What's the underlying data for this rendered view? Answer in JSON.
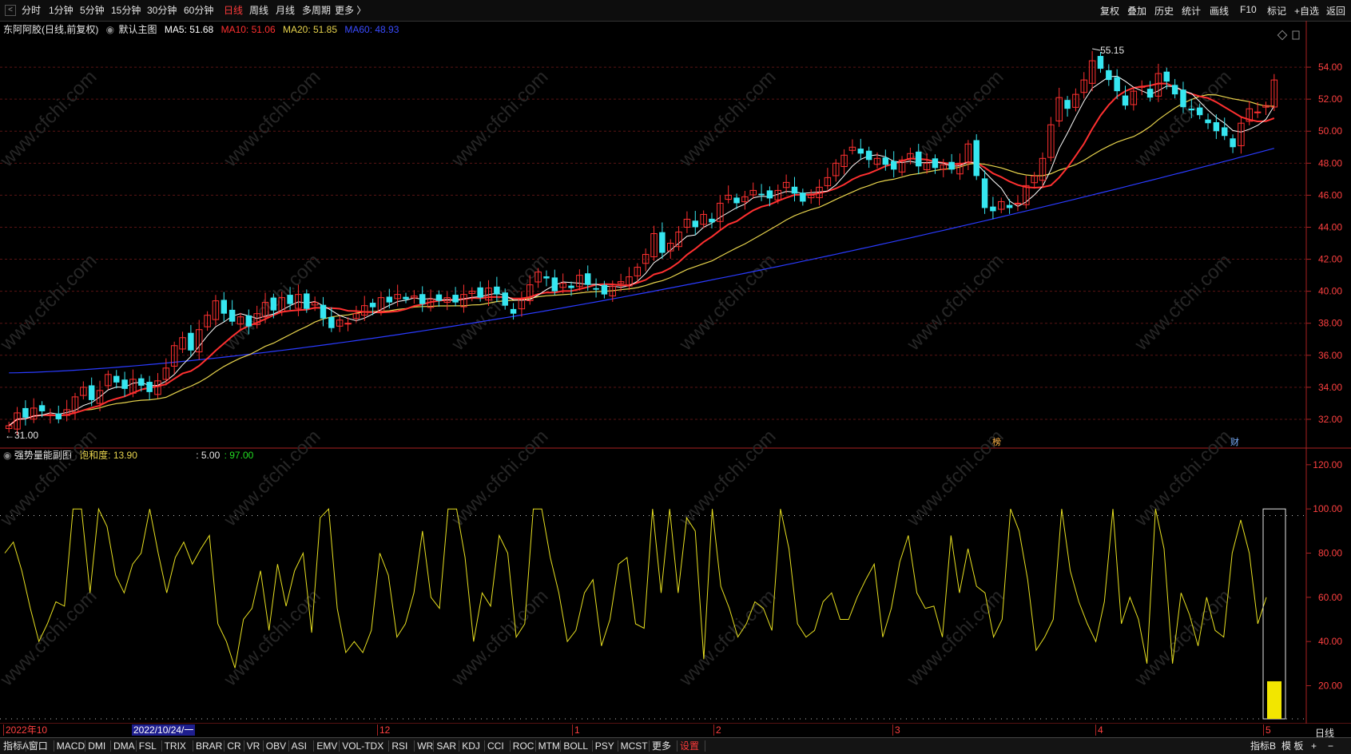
{
  "toolbar": {
    "periods": [
      "分时",
      "1分钟",
      "5分钟",
      "15分钟",
      "30分钟",
      "60分钟",
      "日线",
      "周线",
      "月线",
      "多周期",
      "更多 〉"
    ],
    "active_period": "日线",
    "right_buttons": [
      "复权",
      "叠加",
      "历史",
      "统计",
      "画线",
      "F10",
      "标记",
      "+自选",
      "返回"
    ]
  },
  "legend": {
    "stock": "东阿阿胶(日线,前复权)",
    "main_chart": "默认主图",
    "ma5": "MA5: 51.68",
    "ma10": "MA10: 51.06",
    "ma20": "MA20: 51.85",
    "ma60": "MA60: 48.93",
    "ma5_color": "#ffffff",
    "ma10_color": "#ff3030",
    "ma20_color": "#e8d44d",
    "ma60_color": "#2a3bff"
  },
  "sub_legend": {
    "name": "强势量能副图",
    "saturation": "饱和度: 13.90",
    "v1": ": 5.00",
    "v2": ": 97.00"
  },
  "annotations": {
    "high": "55.15",
    "low": "31.00",
    "marker_bang": "榜",
    "marker_cai": "财",
    "period_label": "日线",
    "cursor_date": "2022/10/24/一"
  },
  "date_axis": [
    "2022年10",
    "12",
    "1",
    "2",
    "3",
    "4",
    "5"
  ],
  "indicator_tabs": [
    "指标A",
    "窗口",
    "MACD",
    "DMI",
    "DMA",
    "FSL",
    "TRIX",
    "BRAR",
    "CR",
    "VR",
    "OBV",
    "ASI",
    "EMV",
    "VOL-TDX",
    "RSI",
    "WR",
    "SAR",
    "KDJ",
    "CCI",
    "ROC",
    "MTM",
    "BOLL",
    "PSY",
    "MCST",
    "更多",
    "设置"
  ],
  "indicator_right": [
    "指标B",
    "模 板",
    "+",
    "−"
  ],
  "chart_data": [
    {
      "type": "candlestick",
      "title": "东阿阿胶(日线,前复权)",
      "ylim": [
        30.5,
        56.2
      ],
      "yticks": [
        32,
        34,
        36,
        38,
        40,
        42,
        44,
        46,
        48,
        50,
        52,
        54
      ],
      "ytick_labels": [
        "32.00",
        "34.00",
        "36.00",
        "38.00",
        "40.00",
        "42.00",
        "44.00",
        "46.00",
        "48.00",
        "50.00",
        "52.00",
        "54.00"
      ],
      "close": [
        31.6,
        32.4,
        32.1,
        32.7,
        32.5,
        32.3,
        32.0,
        32.6,
        33.4,
        34.0,
        33.2,
        33.8,
        34.8,
        34.3,
        33.9,
        34.5,
        34.1,
        33.7,
        34.4,
        35.2,
        36.6,
        37.1,
        36.3,
        37.6,
        38.5,
        39.4,
        38.6,
        38.1,
        38.4,
        37.8,
        38.6,
        39.3,
        38.8,
        39.6,
        39.2,
        39.8,
        38.9,
        39.3,
        38.3,
        37.7,
        38.2,
        38.0,
        38.6,
        39.1,
        39.0,
        39.6,
        39.3,
        39.8,
        39.5,
        39.7,
        39.2,
        39.5,
        39.4,
        39.6,
        39.3,
        39.8,
        40.0,
        39.6,
        40.2,
        39.8,
        39.1,
        38.6,
        39.5,
        40.4,
        41.2,
        40.8,
        40.0,
        40.5,
        40.2,
        41.0,
        40.4,
        40.1,
        39.8,
        40.3,
        40.6,
        40.9,
        41.5,
        42.3,
        43.6,
        42.4,
        43.0,
        43.7,
        44.5,
        44.0,
        44.8,
        44.3,
        45.5,
        46.0,
        45.5,
        45.9,
        46.3,
        46.0,
        45.8,
        46.3,
        46.8,
        46.1,
        45.6,
        46.0,
        46.5,
        47.1,
        48.0,
        48.5,
        49.0,
        48.6,
        48.2,
        48.3,
        47.9,
        47.6,
        48.2,
        48.6,
        47.8,
        48.0,
        47.7,
        47.9,
        47.6,
        48.0,
        49.2,
        47.2,
        45.2,
        45.0,
        45.6,
        45.2,
        45.5,
        46.6,
        47.2,
        48.3,
        50.4,
        52.1,
        51.4,
        52.3,
        53.2,
        54.4,
        53.9,
        53.2,
        52.5,
        51.6,
        52.5,
        52.8,
        52.1,
        53.6,
        53.1,
        52.3,
        51.5,
        51.3,
        51.0,
        50.5,
        50.0,
        49.7,
        49.0,
        50.5,
        51.4,
        51.2,
        51.6,
        53.2
      ],
      "ma5_last": 51.68,
      "ma10_last": 51.06,
      "ma20_last": 51.85,
      "ma60_last": 48.93,
      "high_mark": 55.15,
      "low_mark": 31.0
    },
    {
      "type": "line",
      "title": "强势量能副图",
      "ylim": [
        5,
        125
      ],
      "yticks": [
        20,
        40,
        60,
        80,
        100,
        120
      ],
      "ytick_labels": [
        "20.00",
        "40.00",
        "60.00",
        "80.00",
        "100.00",
        "120.00"
      ],
      "values": [
        80,
        85,
        72,
        55,
        40,
        48,
        58,
        56,
        100,
        100,
        62,
        100,
        92,
        70,
        62,
        75,
        80,
        100,
        80,
        62,
        78,
        85,
        75,
        82,
        88,
        48,
        40,
        28,
        50,
        55,
        72,
        45,
        75,
        56,
        72,
        80,
        44,
        96,
        100,
        55,
        35,
        40,
        35,
        45,
        80,
        70,
        42,
        48,
        62,
        90,
        60,
        55,
        100,
        100,
        78,
        40,
        62,
        56,
        88,
        80,
        42,
        48,
        100,
        100,
        78,
        62,
        40,
        45,
        62,
        68,
        38,
        50,
        75,
        78,
        48,
        46,
        100,
        62,
        100,
        62,
        96,
        90,
        32,
        100,
        65,
        55,
        42,
        48,
        58,
        55,
        45,
        100,
        82,
        48,
        42,
        45,
        58,
        62,
        50,
        50,
        60,
        68,
        75,
        42,
        55,
        76,
        88,
        62,
        55,
        56,
        42,
        88,
        62,
        82,
        65,
        62,
        42,
        50,
        100,
        90,
        68,
        36,
        42,
        50,
        100,
        72,
        58,
        48,
        40,
        58,
        100,
        48,
        60,
        50,
        30,
        100,
        82,
        30,
        62,
        52,
        38,
        60,
        45,
        42,
        80,
        95,
        80,
        48,
        60
      ],
      "current_bar": 22,
      "dotted_levels": [
        5,
        97
      ]
    }
  ]
}
